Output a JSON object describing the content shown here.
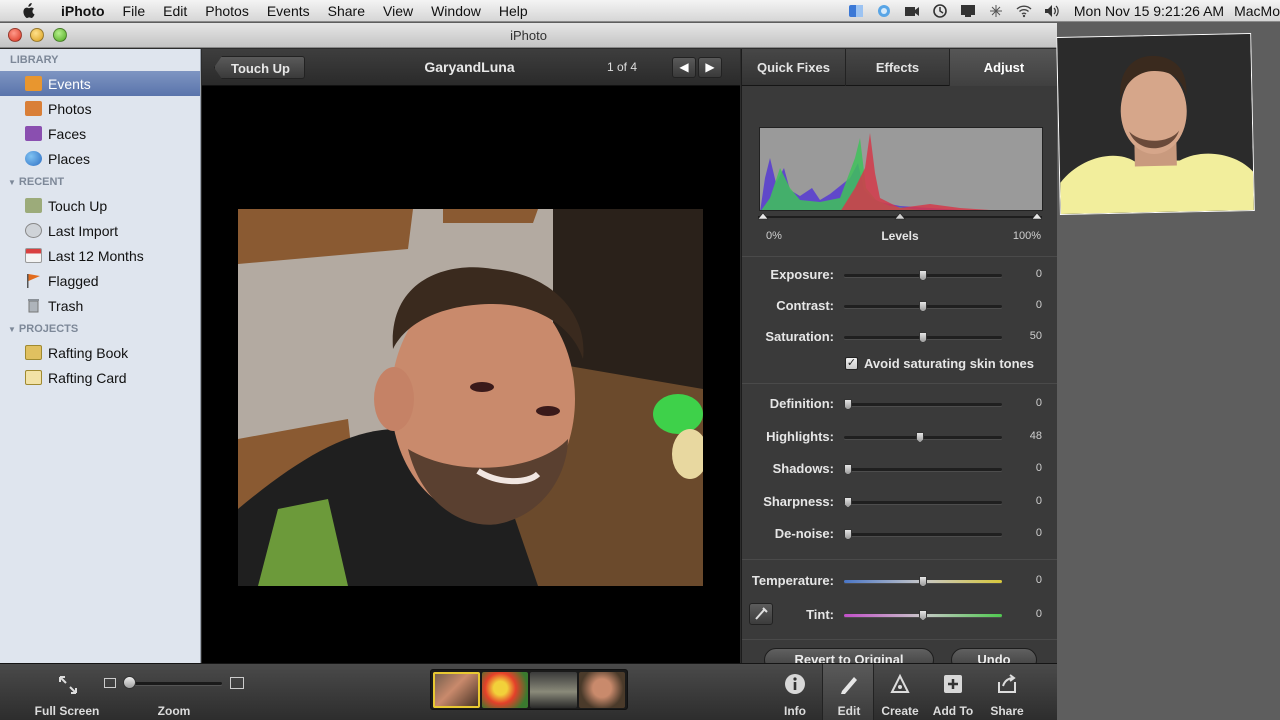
{
  "menubar": {
    "app": "iPhoto",
    "items": [
      "File",
      "Edit",
      "Photos",
      "Events",
      "Share",
      "View",
      "Window",
      "Help"
    ],
    "clock": "Mon Nov 15  9:21:26 AM",
    "host": "MacMo"
  },
  "window": {
    "title": "iPhoto"
  },
  "sidebar": {
    "library_header": "LIBRARY",
    "library_items": [
      {
        "label": "Events",
        "icon": "events-icon",
        "color": "#e8962f"
      },
      {
        "label": "Photos",
        "icon": "photos-icon",
        "color": "#d97f38"
      },
      {
        "label": "Faces",
        "icon": "faces-icon",
        "color": "#8a4fb0"
      },
      {
        "label": "Places",
        "icon": "places-icon",
        "color": "#3c7fd1"
      }
    ],
    "recent_header": "RECENT",
    "recent_items": [
      {
        "label": "Touch Up",
        "icon": "touch-up-icon",
        "color": "#9cab7a"
      },
      {
        "label": "Last Import",
        "icon": "clock-icon",
        "color": "#cfd3d8"
      },
      {
        "label": "Last 12 Months",
        "icon": "calendar-icon",
        "color": "#d94040"
      },
      {
        "label": "Flagged",
        "icon": "flag-icon",
        "color": "#e26b1d"
      },
      {
        "label": "Trash",
        "icon": "trash-icon",
        "color": "#aeb4bb"
      }
    ],
    "projects_header": "PROJECTS",
    "project_items": [
      {
        "label": "Rafting Book",
        "icon": "book-icon",
        "color": "#e0c060"
      },
      {
        "label": "Rafting Card",
        "icon": "card-icon",
        "color": "#e0c060"
      }
    ]
  },
  "viewer": {
    "back_label": "Touch Up",
    "album_title": "GaryandLuna",
    "page_count": "1 of 4",
    "prev_arrow": "◀",
    "next_arrow": "▶"
  },
  "panel": {
    "tabs": [
      "Quick Fixes",
      "Effects",
      "Adjust"
    ],
    "active_tab": "Adjust",
    "levels": {
      "title": "Levels",
      "min_label": "0%",
      "max_label": "100%"
    },
    "sliders_top": [
      {
        "label": "Exposure",
        "value": "0",
        "fraction": 0.5
      },
      {
        "label": "Contrast",
        "value": "0",
        "fraction": 0.5
      },
      {
        "label": "Saturation",
        "value": "50",
        "fraction": 0.5
      }
    ],
    "skin_tones": {
      "label": "Avoid saturating skin tones",
      "checked": true,
      "mark": "✓"
    },
    "sliders_mid": [
      {
        "label": "Definition",
        "value": "0",
        "fraction": 0.0
      },
      {
        "label": "Highlights",
        "value": "48",
        "fraction": 0.48
      },
      {
        "label": "Shadows",
        "value": "0",
        "fraction": 0.0
      },
      {
        "label": "Sharpness",
        "value": "0",
        "fraction": 0.0
      },
      {
        "label": "De-noise",
        "value": "0",
        "fraction": 0.0
      }
    ],
    "sliders_color": [
      {
        "label": "Temperature",
        "value": "0",
        "fraction": 0.5
      },
      {
        "label": "Tint",
        "value": "0",
        "fraction": 0.5
      }
    ],
    "revert_label": "Revert to Original",
    "undo_label": "Undo"
  },
  "toolbar": {
    "full_screen_label": "Full Screen",
    "zoom_label": "Zoom",
    "zoom_level": 0.03,
    "buttons": [
      {
        "label": "Info",
        "icon": "info-icon"
      },
      {
        "label": "Edit",
        "icon": "edit-icon"
      },
      {
        "label": "Create",
        "icon": "create-icon"
      },
      {
        "label": "Add To",
        "icon": "add-to-icon"
      },
      {
        "label": "Share",
        "icon": "share-icon"
      }
    ],
    "active_button": "Edit"
  },
  "colors": {
    "sidebar_bg": "#dfe5ee",
    "selection": "#5a74ab",
    "panel_bg": "#3a3a3a",
    "histogram_bg": "#9a9a9a"
  }
}
